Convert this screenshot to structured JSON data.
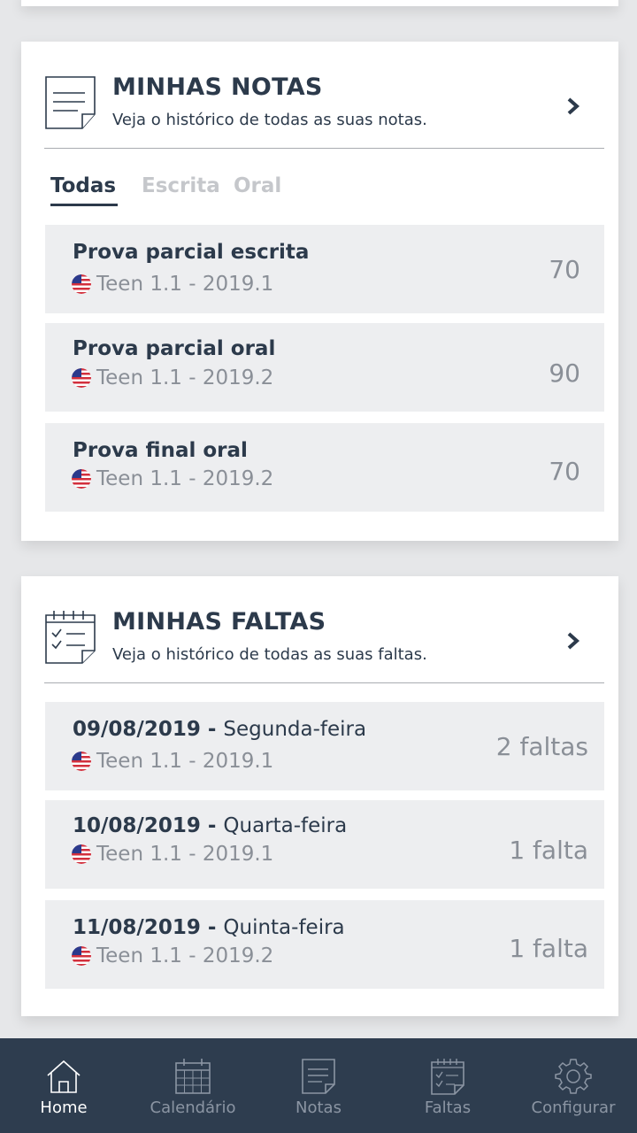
{
  "notas": {
    "title": "MINHAS NOTAS",
    "subtitle": "Veja o histórico de todas as suas notas.",
    "tabs": [
      {
        "label": "Todas",
        "active": true
      },
      {
        "label": "Escrita",
        "active": false
      },
      {
        "label": "Oral",
        "active": false
      }
    ],
    "items": [
      {
        "title": "Prova parcial escrita",
        "course": "Teen 1.1 - 2019.1",
        "grade": "70"
      },
      {
        "title": "Prova parcial oral",
        "course": "Teen 1.1 - 2019.2",
        "grade": "90"
      },
      {
        "title": "Prova final oral",
        "course": "Teen 1.1 - 2019.2",
        "grade": "70"
      }
    ]
  },
  "faltas": {
    "title": "MINHAS FALTAS",
    "subtitle": "Veja o histórico de todas as suas faltas.",
    "items": [
      {
        "date": "09/08/2019",
        "sep": " - ",
        "weekday": "Segunda-feira",
        "course": "Teen 1.1 - 2019.1",
        "count": "2 faltas"
      },
      {
        "date": "10/08/2019",
        "sep": " - ",
        "weekday": "Quarta-feira",
        "course": "Teen 1.1 - 2019.1",
        "count": "1 falta"
      },
      {
        "date": "11/08/2019",
        "sep": " - ",
        "weekday": "Quinta-feira",
        "course": "Teen 1.1 - 2019.2",
        "count": "1 falta"
      }
    ]
  },
  "nav": {
    "items": [
      {
        "label": "Home",
        "icon": "home-icon",
        "active": true
      },
      {
        "label": "Calendário",
        "icon": "calendar-icon",
        "active": false
      },
      {
        "label": "Notas",
        "icon": "notes-icon",
        "active": false
      },
      {
        "label": "Faltas",
        "icon": "absences-icon",
        "active": false
      },
      {
        "label": "Configurar",
        "icon": "gear-icon",
        "active": false
      }
    ]
  },
  "colors": {
    "primary_text": "#2c3a4b",
    "muted_text": "#8a8f97",
    "nav_background": "#2e3d4f",
    "row_background": "#edeef0"
  }
}
